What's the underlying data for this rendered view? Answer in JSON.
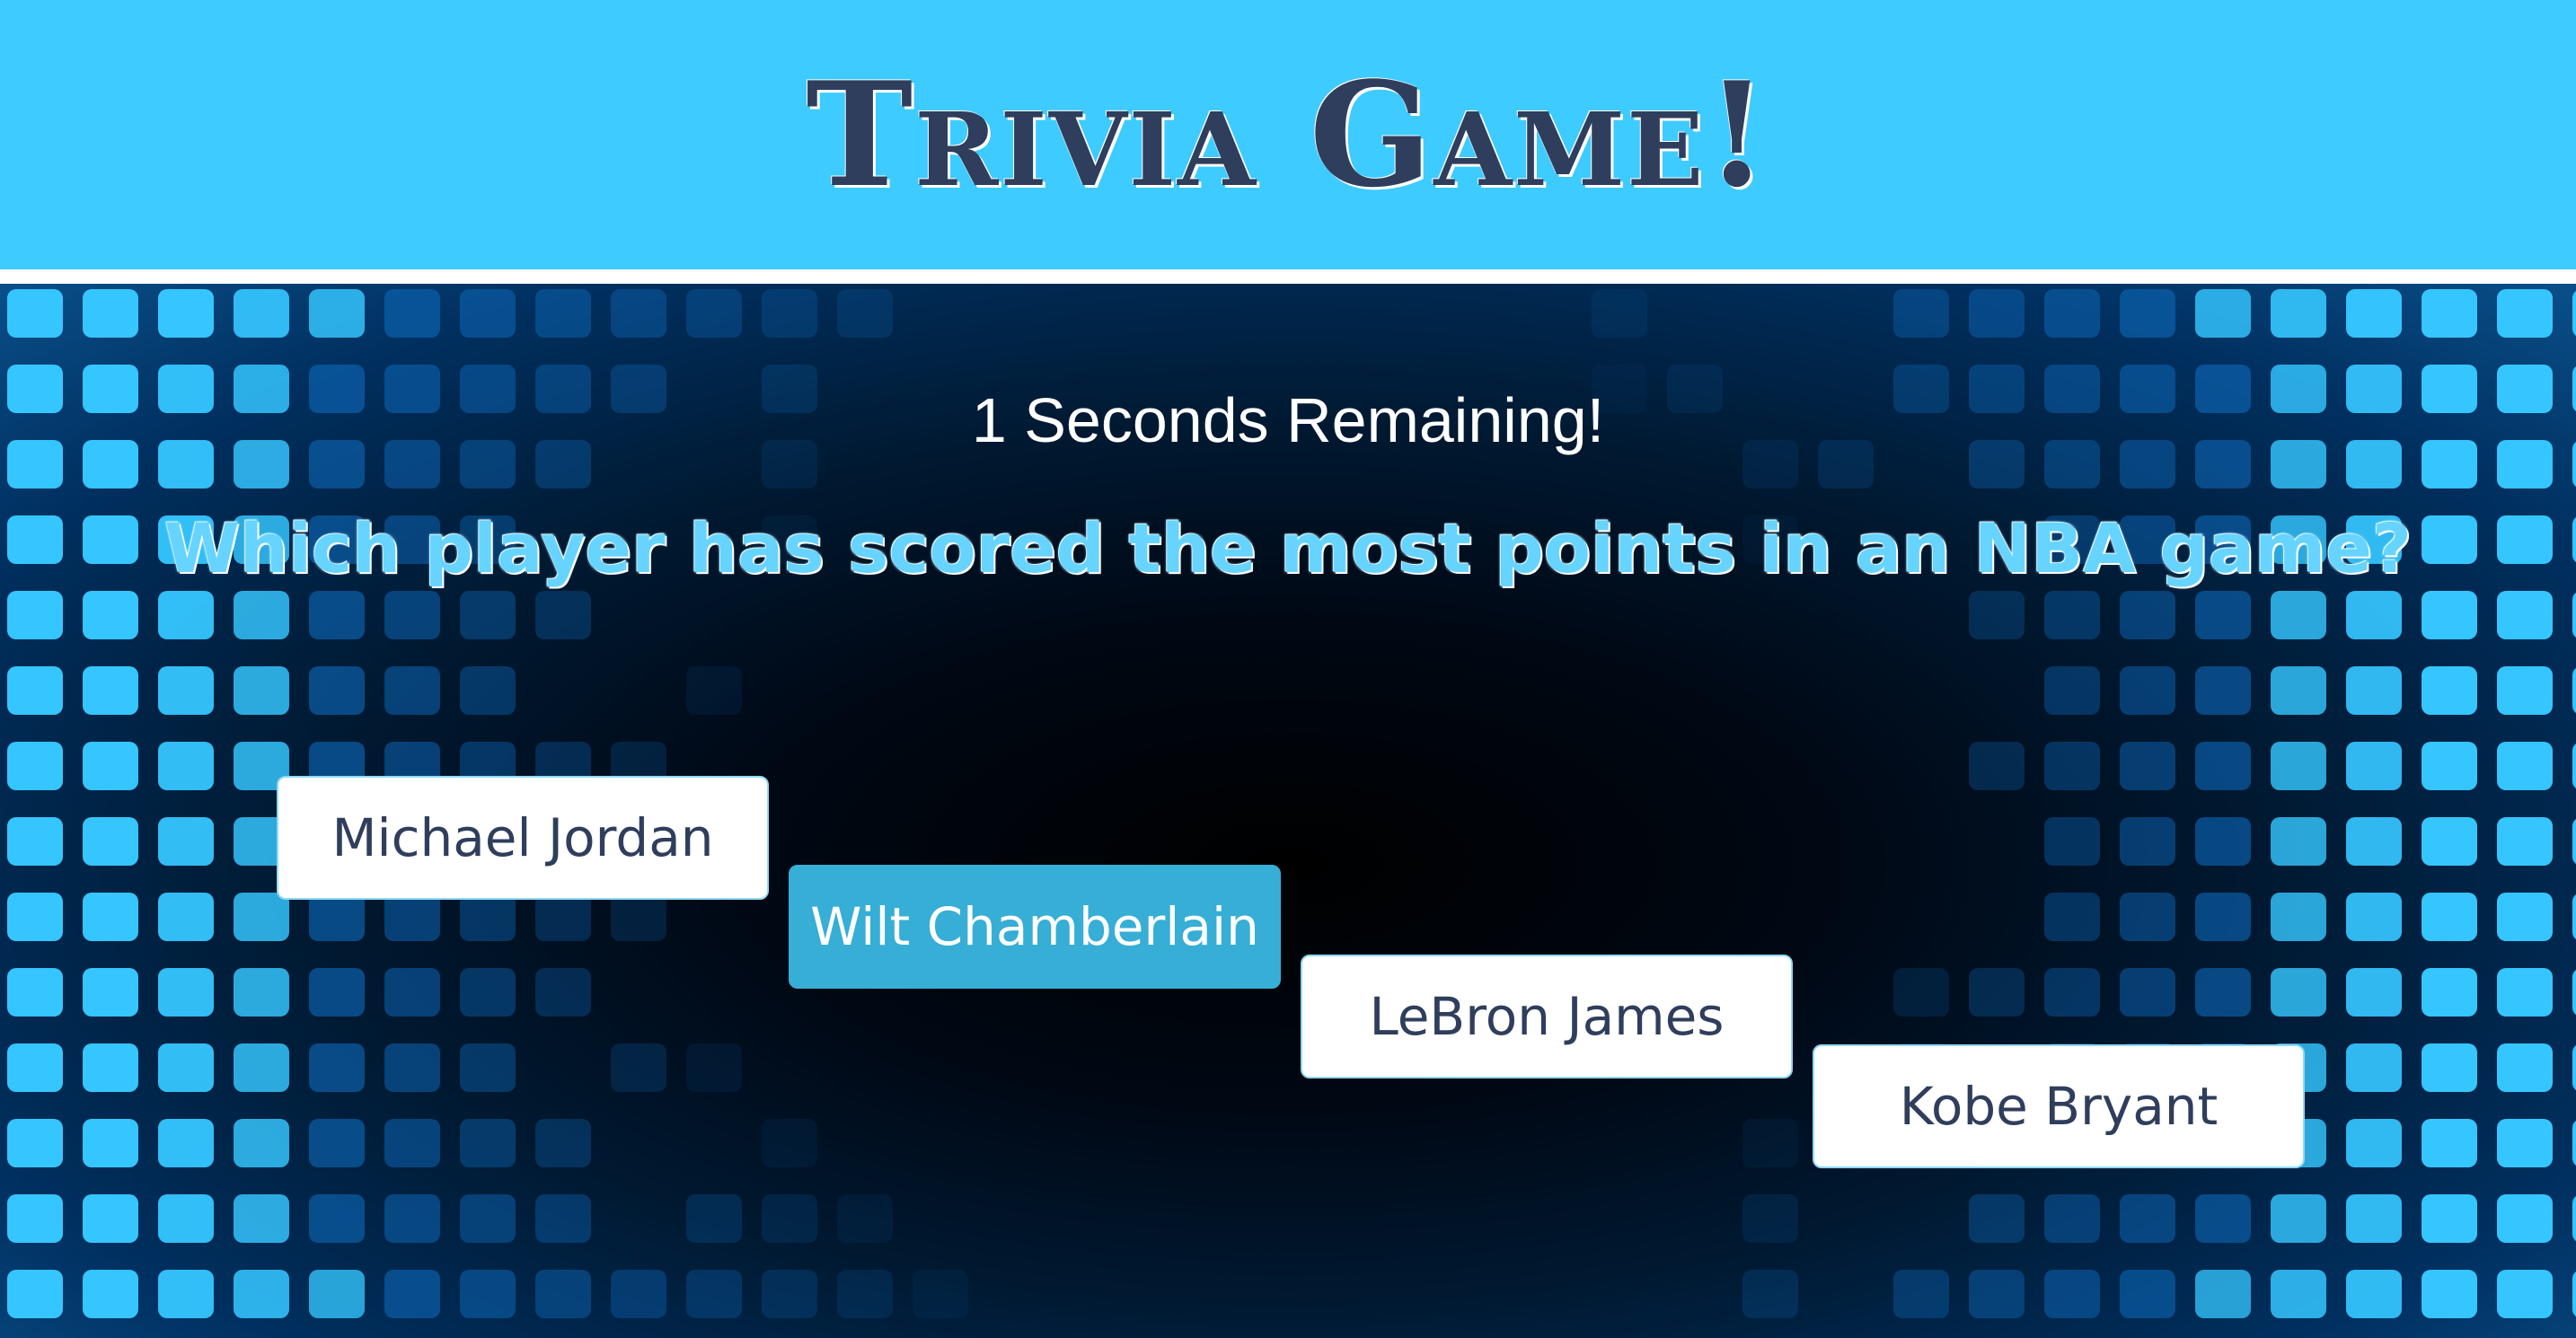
{
  "header": {
    "title": "Trivia Game!"
  },
  "game": {
    "timer_text": "1 Seconds Remaining!",
    "question": "Which player has scored the most points in an NBA game?",
    "answers": [
      {
        "label": "Michael Jordan",
        "selected": false
      },
      {
        "label": "Wilt Chamberlain",
        "selected": true
      },
      {
        "label": "LeBron James",
        "selected": false
      },
      {
        "label": "Kobe Bryant",
        "selected": false
      }
    ]
  },
  "colors": {
    "header_bg": "#3ecbff",
    "title_text": "#2f3e5c",
    "question_text": "#66d4ff",
    "selected_answer_bg": "#36aed6",
    "tile_bright": "#35c6ff",
    "tile_dark": "#0b5ea8"
  }
}
